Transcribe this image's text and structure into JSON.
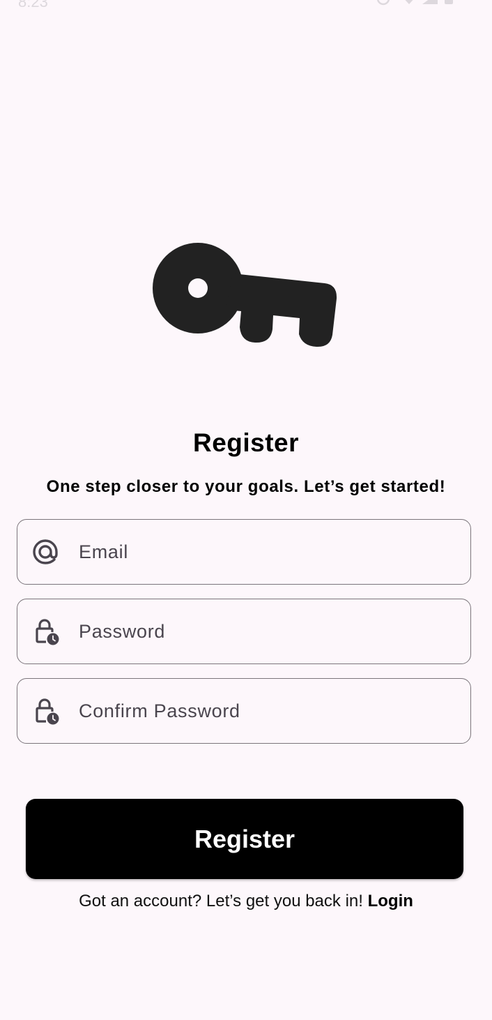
{
  "status_bar": {
    "time": "8:23"
  },
  "logo": {
    "icon": "key-icon",
    "color": "#222222"
  },
  "title": "Register",
  "subtitle": "One step closer to your goals. Let’s get started!",
  "fields": {
    "email": {
      "icon": "at-sign-icon",
      "placeholder": "Email",
      "value": ""
    },
    "password": {
      "icon": "lock-clock-icon",
      "placeholder": "Password",
      "value": ""
    },
    "confirm_password": {
      "icon": "lock-clock-icon",
      "placeholder": "Confirm Password",
      "value": ""
    }
  },
  "register_button": {
    "label": "Register",
    "background": "#000000",
    "text_color": "#ffffff"
  },
  "login_prompt": {
    "text": "Got an account? Let’s get you back in!",
    "link": "Login"
  },
  "colors": {
    "background": "#fdf7fb",
    "field_border": "#7b757b",
    "placeholder": "#4a454e"
  }
}
